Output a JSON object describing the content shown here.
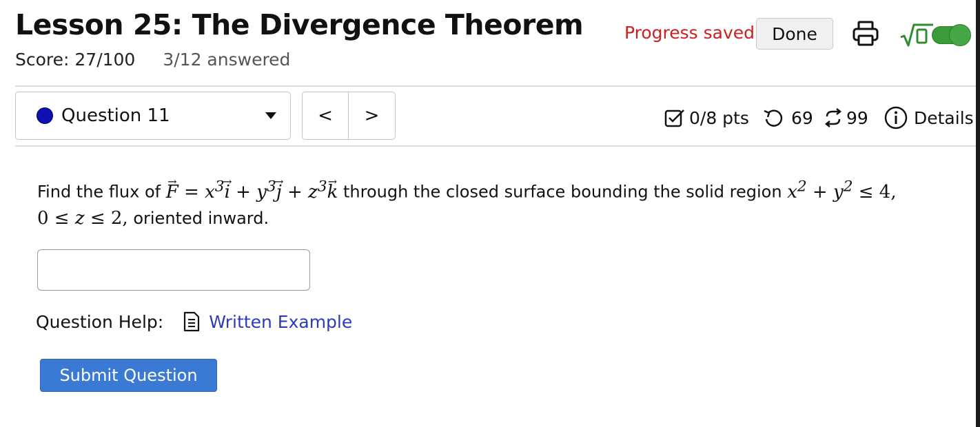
{
  "header": {
    "title": "Lesson 25: The Divergence Theorem",
    "score": "Score: 27/100",
    "answered": "3/12 answered",
    "progress_status": "Progress saved",
    "done_label": "Done",
    "status_color": "#cc2020"
  },
  "question_nav": {
    "selected_question": "Question 11",
    "prev_label": "<",
    "next_label": ">"
  },
  "stats": {
    "points": "0/8 pts",
    "attempts": "69",
    "versions": "99",
    "details_label": "Details"
  },
  "question": {
    "text_prefix": "Find the flux of",
    "text_middle": "through the closed surface bounding the solid region",
    "text_end": "oriented inward."
  },
  "answer": {
    "value": "",
    "placeholder": ""
  },
  "help": {
    "label": "Question Help:",
    "link_label": "Written Example"
  },
  "submit_label": "Submit Question",
  "icons": [
    "print-icon",
    "math-entry-icon",
    "checkbox-icon",
    "retry-icon",
    "refresh-icon",
    "info-icon",
    "document-icon"
  ],
  "colors": {
    "accent": "#3a7ad4",
    "link": "#2a3cb8",
    "toggle_on": "#3a9b3a",
    "question_dot": "#1010b0"
  }
}
